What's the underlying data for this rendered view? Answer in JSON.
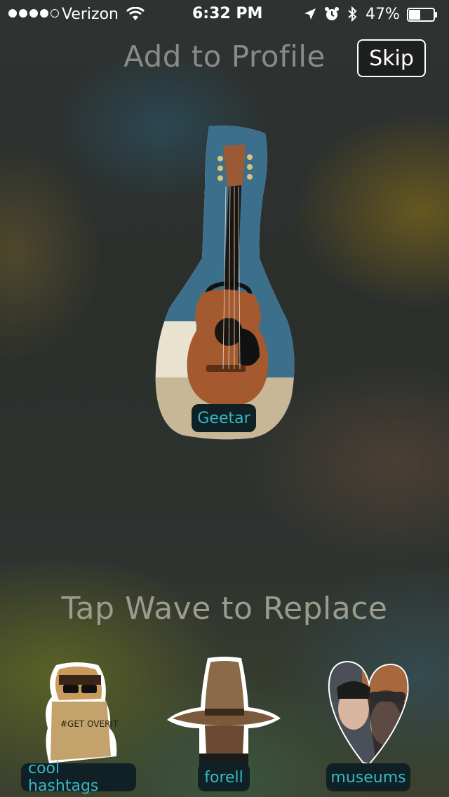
{
  "status_bar": {
    "carrier": "Verizon",
    "time": "6:32 PM",
    "battery": "47%",
    "signal_bars_filled": 4,
    "signal_bars_total": 5,
    "battery_level": 0.47,
    "icons": [
      "wifi-icon",
      "location-arrow-icon",
      "alarm-icon",
      "bluetooth-icon",
      "battery-icon"
    ]
  },
  "header": {
    "title": "Add to Profile",
    "skip_label": "Skip"
  },
  "selected_sticker": {
    "label": "Geetar"
  },
  "instruction": "Tap Wave to Replace",
  "replace_options": [
    {
      "label": "cool hashtags",
      "sticker_text": "#GET OVERIT"
    },
    {
      "label": "forell"
    },
    {
      "label": "museums"
    }
  ],
  "colors": {
    "tag_text": "#3ab6c4",
    "tag_bg": "#0f2124"
  }
}
